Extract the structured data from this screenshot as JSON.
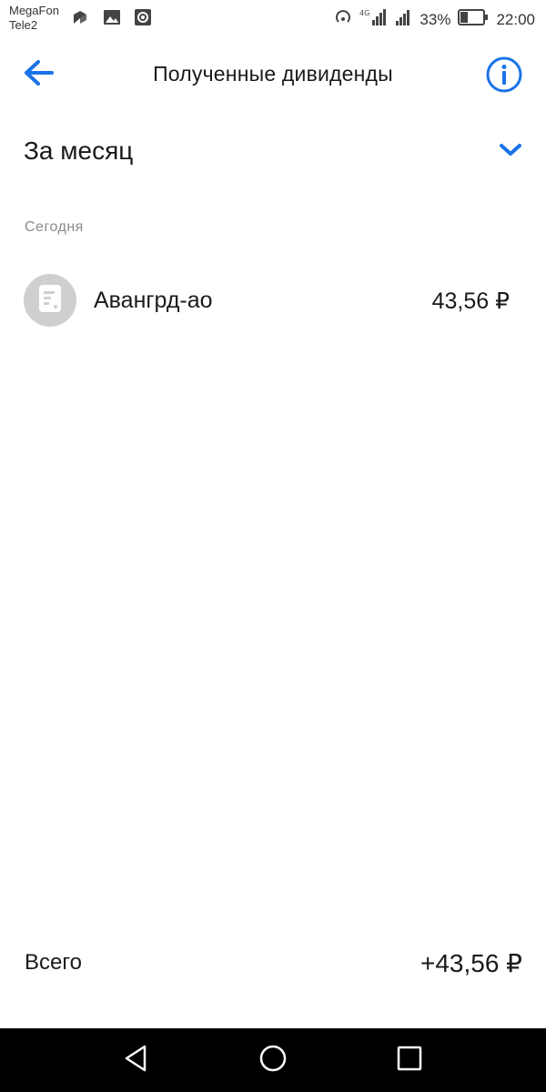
{
  "status_bar": {
    "carrier_1": "MegaFon",
    "carrier_2": "Tele2",
    "network": "4G",
    "battery_percent": "33%",
    "battery_level": 0.33,
    "time": "22:00",
    "icons": [
      "notification-icon",
      "image-icon",
      "target-icon",
      "hotspot-icon",
      "signal-icon",
      "battery-icon"
    ]
  },
  "header": {
    "title": "Полученные дивиденды",
    "back_icon": "arrow-left-icon",
    "info_icon": "info-icon"
  },
  "period": {
    "label": "За месяц",
    "icon": "chevron-down-icon"
  },
  "section": {
    "title": "Сегодня"
  },
  "items": [
    {
      "name": "Авангрд-ао",
      "amount": "43,56 ₽",
      "icon": "document-icon"
    }
  ],
  "total": {
    "label": "Всего",
    "value": "+43,56 ₽"
  },
  "colors": {
    "accent": "#1a73e8",
    "text": "#1a1a1a",
    "muted": "#8a8a8a",
    "avatar_bg": "#cfcfcf"
  }
}
